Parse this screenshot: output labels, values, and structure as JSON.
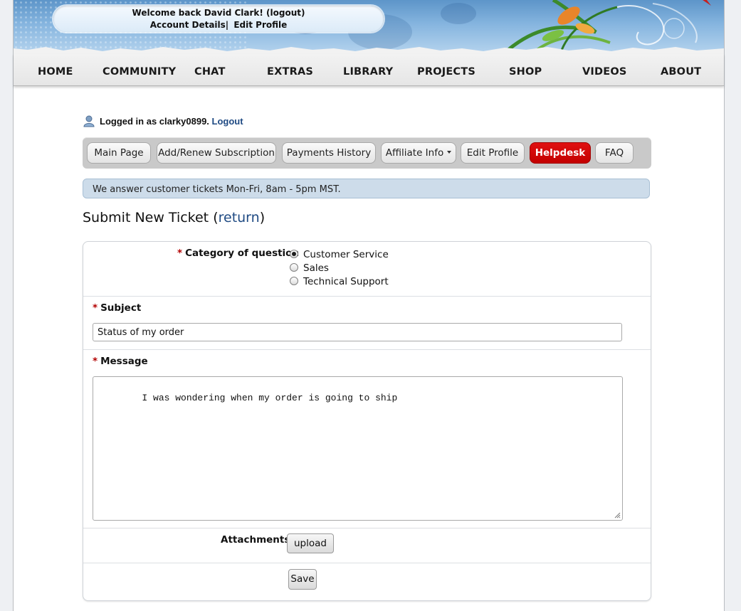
{
  "welcome": {
    "greeting": "Welcome back David Clark! (logout)",
    "account_details": "Account Details",
    "separator": "|",
    "edit_profile": "Edit Profile"
  },
  "nav": {
    "items": [
      "HOME",
      "COMMUNITY",
      "CHAT",
      "EXTRAS",
      "LIBRARY",
      "PROJECTS",
      "SHOP",
      "VIDEOS",
      "ABOUT"
    ]
  },
  "login": {
    "text": "Logged in as clarky0899.",
    "logout": "Logout",
    "icon": "user-icon"
  },
  "tabs": {
    "items": [
      "Main Page",
      "Add/Renew Subscription",
      "Payments History",
      "Affiliate Info",
      "Edit Profile",
      "Helpdesk",
      "FAQ"
    ],
    "active": "Helpdesk",
    "active_color": "#d40a0a"
  },
  "notice": {
    "text": "We answer customer tickets Mon-Fri, 8am - 5pm MST."
  },
  "heading": {
    "title": "Submit New Ticket",
    "open_paren": "(",
    "return_link": "return",
    "close_paren": ")"
  },
  "form": {
    "required_mark": "*",
    "category": {
      "label": "Category of question",
      "options": [
        "Customer Service",
        "Sales",
        "Technical Support"
      ],
      "selected": "Customer Service"
    },
    "subject": {
      "label": "Subject",
      "value": "Status of my order"
    },
    "message": {
      "label": "Message",
      "value": "I was wondering when my order is going to ship"
    },
    "attachments": {
      "label": "Attachments",
      "button": "upload"
    },
    "save_button": "Save"
  }
}
